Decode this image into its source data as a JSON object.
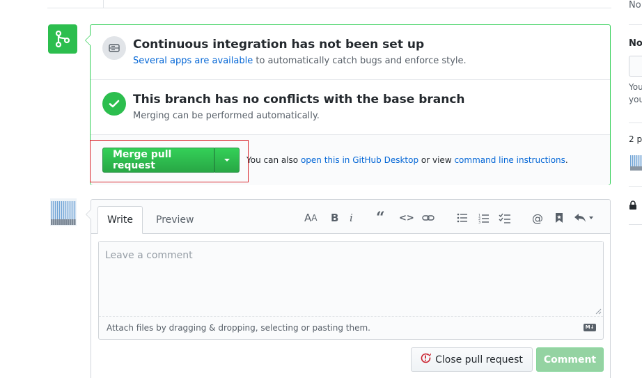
{
  "merge": {
    "ci": {
      "title": "Continuous integration has not been set up",
      "link": "Several apps are available",
      "rest": " to automatically catch bugs and enforce style."
    },
    "conflicts": {
      "title": "This branch has no conflicts with the base branch",
      "sub": "Merging can be performed automatically."
    },
    "button_label": "Merge pull request",
    "hint_prefix": "You can also ",
    "hint_link1": "open this in GitHub Desktop",
    "hint_mid": " or view ",
    "hint_link2": "command line instructions",
    "hint_suffix": "."
  },
  "comment": {
    "tabs": {
      "write": "Write",
      "preview": "Preview"
    },
    "toolbar_icons": [
      "text-size-icon",
      "bold-icon",
      "italic-icon",
      "quote-icon",
      "code-icon",
      "link-icon",
      "bullet-list-icon",
      "numbered-list-icon",
      "task-list-icon",
      "mention-icon",
      "bookmark-icon",
      "reply-icon"
    ],
    "placeholder": "Leave a comment",
    "attach_text": "Attach files by dragging & dropping, selecting or pasting them.",
    "markdown_badge": "M↓",
    "close_label": "Close pull request",
    "comment_label": "Comment"
  },
  "sidebar": {
    "t1": "No",
    "t2": "No",
    "t3": "You",
    "t4": "you",
    "t5": "2 p"
  },
  "colors": {
    "accent_green": "#2cbe4e",
    "link_blue": "#0366d6",
    "highlight_red": "#d9282e"
  }
}
